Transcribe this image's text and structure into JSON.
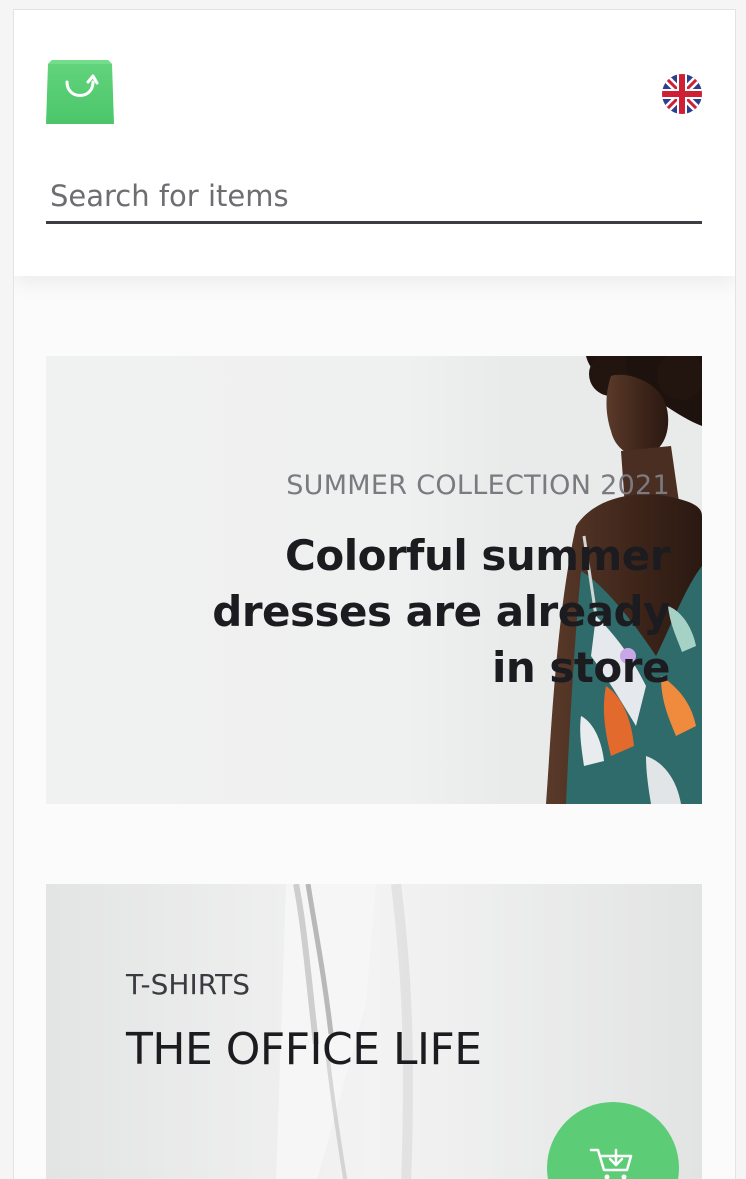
{
  "header": {
    "logo_icon": "shopping-bag-icon",
    "language_icon": "uk-flag-icon"
  },
  "search": {
    "placeholder": "Search for items",
    "value": ""
  },
  "banners": [
    {
      "eyebrow": "SUMMER COLLECTION 2021",
      "title": "Colorful summer dresses are already in store"
    },
    {
      "eyebrow": "T-SHIRTS",
      "title": "THE OFFICE LIFE"
    }
  ],
  "fab": {
    "icon": "cart-add-icon"
  },
  "colors": {
    "accent": "#5dcc77",
    "text_dark": "#1c1c20",
    "text_muted": "#7a7a80"
  }
}
